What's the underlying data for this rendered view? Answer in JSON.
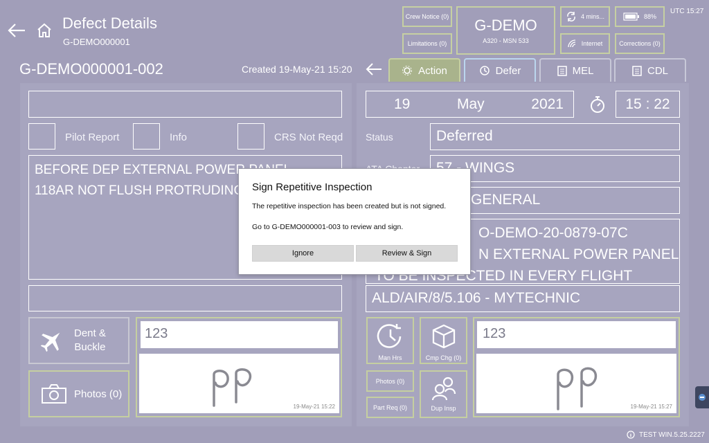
{
  "header": {
    "title": "Defect Details",
    "subtitle": "G-DEMO000001",
    "defect_id": "G-DEMO000001-002",
    "created": "Created 19-May-21 15:20",
    "utc": "UTC 15:27",
    "crew_notice": "Crew Notice (0)",
    "limitations": "Limitations (0)",
    "aircraft_reg": "G-DEMO",
    "aircraft_type": "A320 - MSN 533",
    "sync": "4 mins...",
    "battery": "88%",
    "internet": "Internet",
    "corrections": "Corrections (0)"
  },
  "tabs": [
    {
      "label": "Action",
      "icon": "gear-icon"
    },
    {
      "label": "Defer",
      "icon": "clock-arrow-icon"
    },
    {
      "label": "MEL",
      "icon": "clipboard-icon"
    },
    {
      "label": "CDL",
      "icon": "clipboard-icon"
    }
  ],
  "left": {
    "checkboxes": [
      "Pilot Report",
      "Info",
      "CRS Not Reqd"
    ],
    "description_line1": "BEFORE DEP EXTERNAL POWER PANEL",
    "description_line2": "118AR NOT FLUSH PROTRUDING",
    "dent_buckle": "Dent &",
    "dent_buckle_2": "Buckle",
    "photos": "Photos (0)",
    "auth_code": "123",
    "signature_time": "19-May-21 15:22"
  },
  "right": {
    "day": "19",
    "month": "May",
    "year": "2021",
    "time": "15 : 22",
    "status_label": "Status",
    "status_value": "Deferred",
    "ata_label": "ATA Chapter",
    "ata_value": "57 - WINGS",
    "ata_sub": "GENERAL",
    "text_line1": "O-DEMO-20-0879-07C",
    "text_line2": "N EXTERNAL POWER PANEL",
    "text_line3": "TO BE INSPECTED IN EVERY FLIGHT",
    "reference": "ALD/AIR/8/5.106 - MYTECHNIC",
    "man_hrs": "Man Hrs",
    "cmp_chg": "Cmp Chg (0)",
    "photos": "Photos (0)",
    "part_req": "Part Req (0)",
    "dup_insp": "Dup Insp",
    "auth_code": "123",
    "signature_time": "19-May-21 15:27"
  },
  "dialog": {
    "title": "Sign Repetitive Inspection",
    "message1": "The repetitive inspection has been created but is not signed.",
    "message2": "Go to G-DEMO000001-003 to review and sign.",
    "ignore": "Ignore",
    "review_sign": "Review & Sign"
  },
  "footer": {
    "version": "TEST WIN.5.25.2227"
  }
}
